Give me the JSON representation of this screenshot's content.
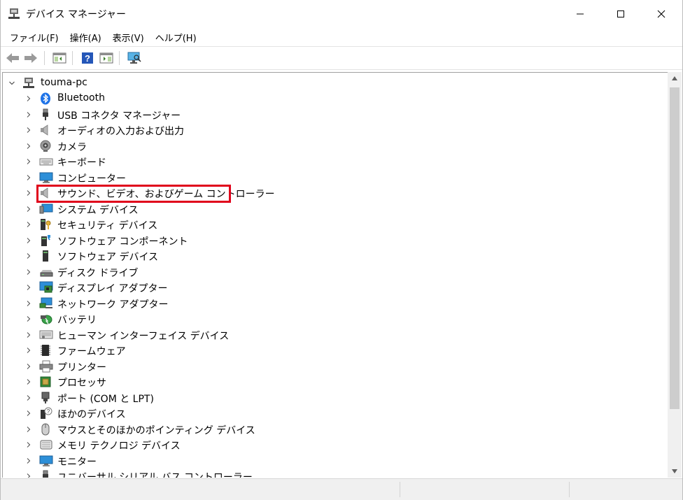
{
  "window": {
    "title": "デバイス マネージャー",
    "controls": [
      "minimize",
      "maximize",
      "close"
    ]
  },
  "menubar": {
    "items": [
      "ファイル(F)",
      "操作(A)",
      "表示(V)",
      "ヘルプ(H)"
    ]
  },
  "toolbar": {
    "buttons": [
      "back-icon",
      "forward-icon",
      "show-hide-console-tree-icon",
      "help-icon",
      "action-pane-icon",
      "scan-hardware-icon"
    ]
  },
  "tree": {
    "root": "touma-pc",
    "items": [
      {
        "label": "Bluetooth",
        "icon": "bluetooth-icon"
      },
      {
        "label": "USB コネクタ マネージャー",
        "icon": "usb-connector-icon"
      },
      {
        "label": "オーディオの入力および出力",
        "icon": "speaker-icon"
      },
      {
        "label": "カメラ",
        "icon": "camera-icon"
      },
      {
        "label": "キーボード",
        "icon": "keyboard-icon"
      },
      {
        "label": "コンピューター",
        "icon": "monitor-icon"
      },
      {
        "label": "サウンド、ビデオ、およびゲーム コントローラー",
        "icon": "speaker-icon",
        "highlighted": true
      },
      {
        "label": "システム デバイス",
        "icon": "system-device-icon"
      },
      {
        "label": "セキュリティ デバイス",
        "icon": "security-device-icon"
      },
      {
        "label": "ソフトウェア コンポーネント",
        "icon": "software-component-icon"
      },
      {
        "label": "ソフトウェア デバイス",
        "icon": "software-device-icon"
      },
      {
        "label": "ディスク ドライブ",
        "icon": "disk-drive-icon"
      },
      {
        "label": "ディスプレイ アダプター",
        "icon": "display-adapter-icon"
      },
      {
        "label": "ネットワーク アダプター",
        "icon": "network-adapter-icon"
      },
      {
        "label": "バッテリ",
        "icon": "battery-icon"
      },
      {
        "label": "ヒューマン インターフェイス デバイス",
        "icon": "hid-icon"
      },
      {
        "label": "ファームウェア",
        "icon": "firmware-icon"
      },
      {
        "label": "プリンター",
        "icon": "printer-icon"
      },
      {
        "label": "プロセッサ",
        "icon": "processor-icon"
      },
      {
        "label": "ポート (COM と LPT)",
        "icon": "port-icon"
      },
      {
        "label": "ほかのデバイス",
        "icon": "other-device-icon"
      },
      {
        "label": "マウスとそのほかのポインティング デバイス",
        "icon": "mouse-icon"
      },
      {
        "label": "メモリ テクノロジ デバイス",
        "icon": "memory-tech-icon"
      },
      {
        "label": "モニター",
        "icon": "monitor-icon"
      },
      {
        "label": "ユニバーサル シリアル バス コントローラー",
        "icon": "usb-controller-icon"
      }
    ]
  },
  "colors": {
    "highlight": "#e0001b",
    "bluetooth": "#1e73e8",
    "monitor": "#2d8fd8"
  }
}
